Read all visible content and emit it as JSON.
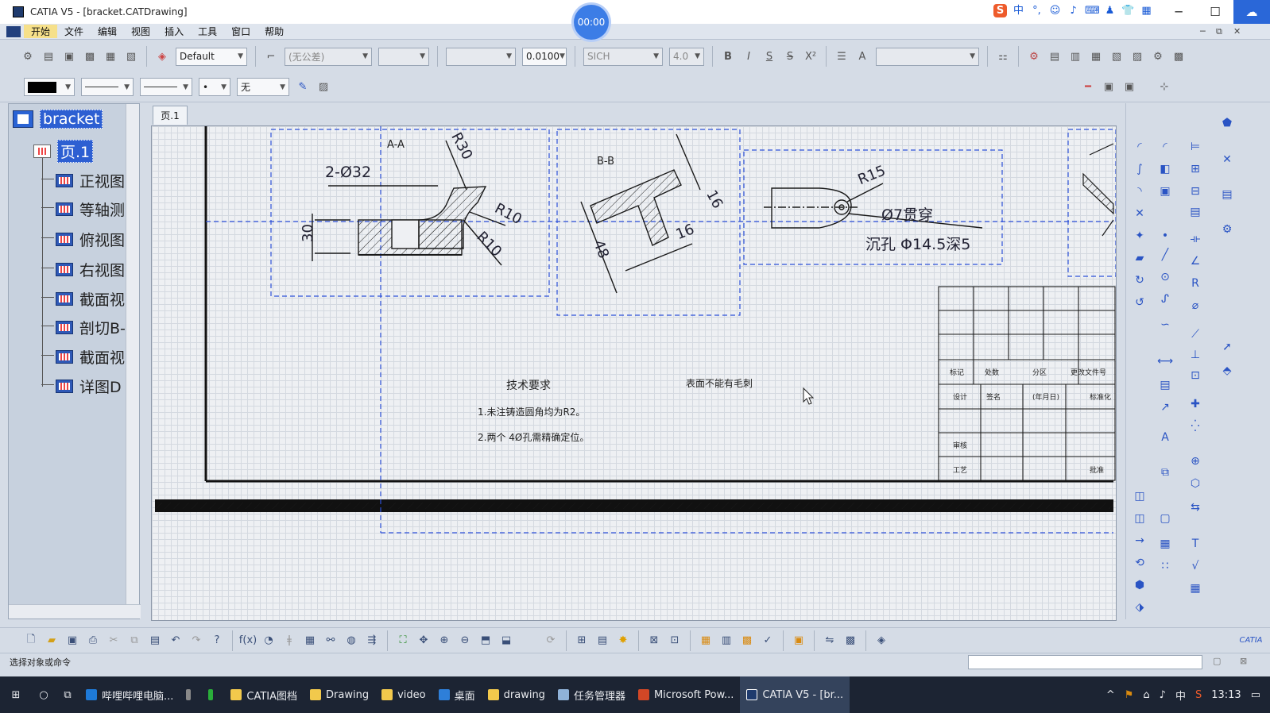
{
  "window": {
    "title": "CATIA V5 - [bracket.CATDrawing]",
    "timer": "00:00"
  },
  "ime": [
    "S",
    "中",
    "°,",
    "☺",
    "♪",
    "⌨",
    "♟",
    "👕",
    "▦"
  ],
  "menu": [
    "开始",
    "文件",
    "编辑",
    "视图",
    "插入",
    "工具",
    "窗口",
    "帮助"
  ],
  "toolbar": {
    "style_value": "Default",
    "tolerance_value": "(无公差)",
    "precision_value": "0.0100",
    "font_value": "SICH",
    "font_size_value": "4.0",
    "bold": "B",
    "italic": "I",
    "underline": "S",
    "strike": "S",
    "superscript": "X²",
    "line_fill_value": "无"
  },
  "tree": {
    "root": "bracket",
    "sheet": "页.1",
    "views": [
      "正视图",
      "等轴测",
      "俯视图",
      "右视图",
      "截面视",
      "剖切B-",
      "截面视",
      "详图D"
    ]
  },
  "sheet_tab": "页.1",
  "drawing": {
    "section_aa": "A-A",
    "section_bb": "B-B",
    "dim_2_d32": "2-Ø32",
    "dim_r30": "R30",
    "dim_r10_a": "R10",
    "dim_r10_b": "R10",
    "dim_30": "30",
    "dim_16_a": "16",
    "dim_16_b": "16",
    "dim_48": "48",
    "dim_r15": "R15",
    "hole_note": "Ø7贯穿",
    "counterbore_note": "沉孔 Φ14.5深5",
    "tech_req_title": "技术要求",
    "tech_req_1": "1.未注铸造圆角均为R2。",
    "tech_req_2": "2.两个  4Ø孔需精确定位。",
    "surface_note": "表面不能有毛刺",
    "title_block": {
      "r1": [
        "标记",
        "处数",
        "分区",
        "更改文件号"
      ],
      "r2": [
        "设计",
        "签名",
        "(年月日)",
        "标准化"
      ],
      "r3": [
        "审核"
      ],
      "r4": [
        "工艺",
        "批准"
      ]
    }
  },
  "status": {
    "message": "选择对象或命令"
  },
  "taskbar": {
    "items": [
      "哔哩哔哩电脑...",
      "CATIA图档",
      "Drawing",
      "video",
      "桌面",
      "drawing",
      "任务管理器",
      "Microsoft Pow...",
      "CATIA V5 - [br..."
    ],
    "ime": "中",
    "time": "13:13"
  },
  "colors": {
    "accent": "#2d5fd2",
    "frame": "#1a1a1a",
    "view_frame": "#2c4fd8"
  }
}
